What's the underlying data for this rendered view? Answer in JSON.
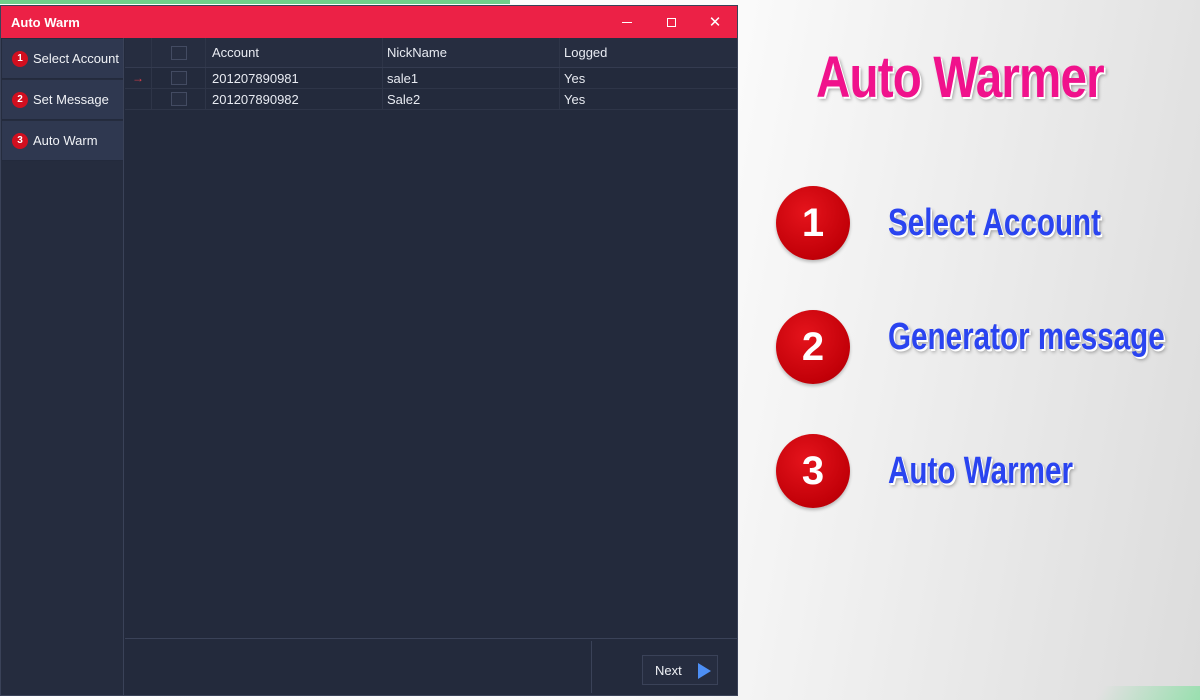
{
  "window": {
    "title": "Auto Warm",
    "controls": {
      "minimize": "minimize",
      "maximize": "maximize",
      "close": "close"
    }
  },
  "sidebar": {
    "items": [
      {
        "number": "1",
        "label": "Select Account"
      },
      {
        "number": "2",
        "label": "Set Message"
      },
      {
        "number": "3",
        "label": "Auto Warm"
      }
    ]
  },
  "grid": {
    "columns": [
      "Account",
      "NickName",
      "Logged"
    ],
    "rows": [
      {
        "current": true,
        "indicator": "→",
        "account": "201207890981",
        "nickname": "sale1",
        "logged": "Yes"
      },
      {
        "current": false,
        "indicator": "",
        "account": "201207890982",
        "nickname": "Sale2",
        "logged": "Yes"
      }
    ]
  },
  "footer": {
    "next_label": "Next"
  },
  "promo": {
    "title": "Auto Warmer",
    "steps": [
      {
        "number": "1",
        "label": "Select Account"
      },
      {
        "number": "2",
        "label": "Generator message"
      },
      {
        "number": "3",
        "label": "Auto Warmer"
      }
    ]
  },
  "colors": {
    "titlebar": "#ec2146",
    "window_bg": "#232a3c",
    "badge": "#d10f1f",
    "promo_title": "#f0128c",
    "promo_step_text": "#2a44f0",
    "next_arrow": "#4d8ff5"
  }
}
